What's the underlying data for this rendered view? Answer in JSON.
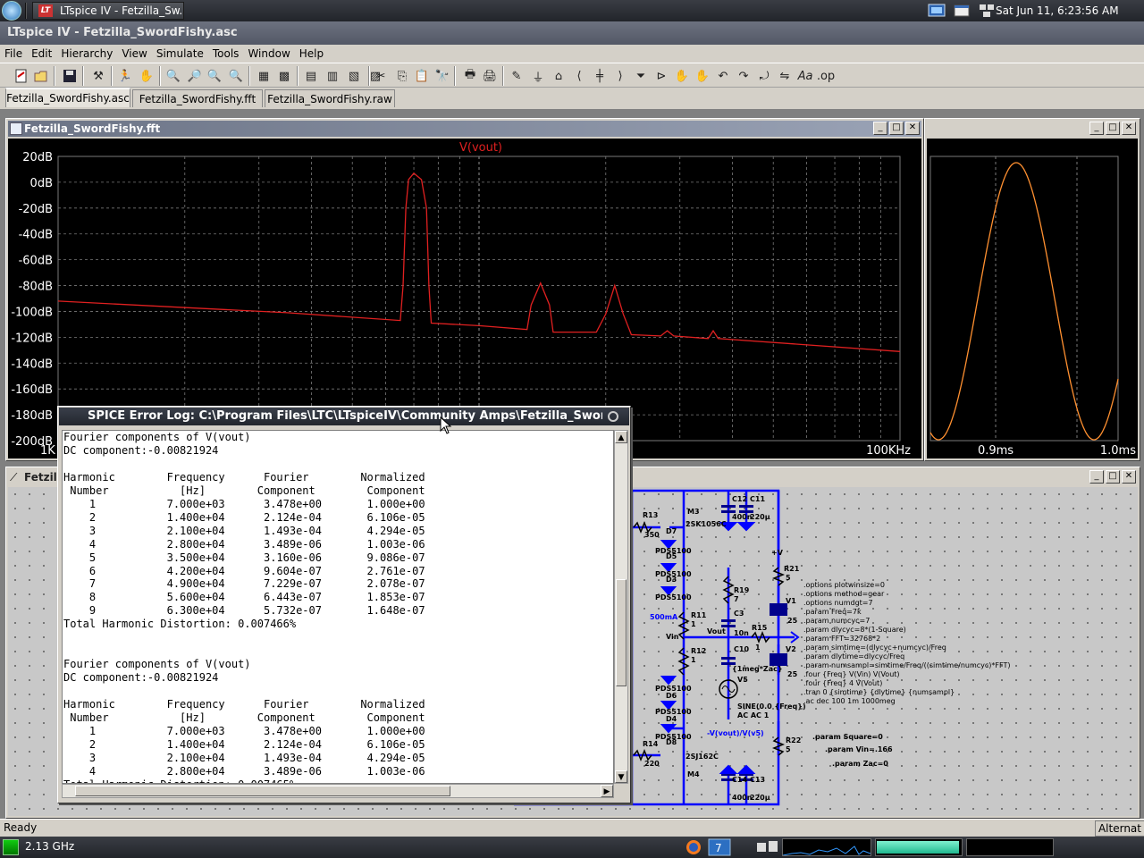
{
  "system_panel": {
    "task_title": "LTspice IV - Fetzilla_Sw...",
    "clock": "Sat Jun 11,  6:23:56 AM"
  },
  "app": {
    "title": "LTspice IV - Fetzilla_SwordFishy.asc",
    "menu": [
      "File",
      "Edit",
      "Hierarchy",
      "View",
      "Simulate",
      "Tools",
      "Window",
      "Help"
    ],
    "tabs": [
      "Fetzilla_SwordFishy.asc",
      "Fetzilla_SwordFishy.fft",
      "Fetzilla_SwordFishy.raw"
    ],
    "active_tab": 0
  },
  "fft_window": {
    "title": "Fetzilla_SwordFishy.fft",
    "trace_label": "V(vout)",
    "colors": {
      "trace": "#e02020",
      "grid": "#7a7a7a",
      "axis_text": "#ffffff",
      "background": "#000000"
    }
  },
  "chart_data": [
    {
      "type": "line",
      "title": "V(vout)",
      "xscale": "log",
      "xlim": [
        1000,
        100000
      ],
      "x_ticks": [
        "1K",
        "100KHz"
      ],
      "ylim": [
        -200,
        20
      ],
      "y_ticks": [
        "20dB",
        "0dB",
        "-20dB",
        "-40dB",
        "-60dB",
        "-80dB",
        "-100dB",
        "-120dB",
        "-140dB",
        "-160dB",
        "-180dB",
        "-200dB"
      ],
      "series": [
        {
          "name": "V(vout)",
          "color": "#e02020",
          "points": [
            [
              1000,
              -92
            ],
            [
              3500,
              -101
            ],
            [
              6500,
              -107
            ],
            [
              6600,
              -80
            ],
            [
              6700,
              -20
            ],
            [
              6800,
              2
            ],
            [
              7000,
              7
            ],
            [
              7300,
              2
            ],
            [
              7500,
              -20
            ],
            [
              7600,
              -80
            ],
            [
              7700,
              -109
            ],
            [
              10000,
              -111
            ],
            [
              13000,
              -114
            ],
            [
              13300,
              -95
            ],
            [
              14000,
              -78
            ],
            [
              14700,
              -95
            ],
            [
              15000,
              -116
            ],
            [
              19000,
              -116
            ],
            [
              20000,
              -102
            ],
            [
              21000,
              -80
            ],
            [
              22000,
              -102
            ],
            [
              23000,
              -118
            ],
            [
              27000,
              -119
            ],
            [
              28000,
              -115
            ],
            [
              29000,
              -119
            ],
            [
              35000,
              -121
            ],
            [
              36000,
              -115
            ],
            [
              37000,
              -121
            ],
            [
              100000,
              -131
            ]
          ]
        }
      ]
    },
    {
      "type": "line",
      "title": "",
      "x_ticks": [
        "0.9ms",
        "1.0ms"
      ],
      "series": [
        {
          "color": "#ff9030",
          "shape": "sine"
        }
      ]
    }
  ],
  "scope_window": {
    "colors": {
      "trace": "#ff9030"
    }
  },
  "schematic_window": {
    "title": "Fetzilla_SwordFishy.asc",
    "colors": {
      "wire": "#0000ff",
      "text": "#000000"
    },
    "labels": {
      "r13": "R13",
      "r13v": "350",
      "m3": "M3",
      "m3v": "2SK1056C",
      "d7": "D7",
      "d5": "D5",
      "d3": "D3",
      "pd1": "PDS5100",
      "pd2": "PDS5100",
      "pd3": "PDS5100",
      "c12": "C12",
      "c11": "C11",
      "c12v": "400n",
      "c11v": "220µ",
      "r11": "R11",
      "r11v": "1",
      "r19": "R19",
      "r19v": "7",
      "c3": "C3",
      "c3v": "10n",
      "vout": "Vout",
      "vin": "Vin",
      "r15": "R15",
      "r15v": "1",
      "r12": "R12",
      "r12v": "1",
      "c10": "C10",
      "c10v": "{1meg*Zac}",
      "v5": "V5",
      "sine": "SINE(0.0 {Freq})",
      "acac": "AC AC 1",
      "ratio": "-V(vout)/V(v5)",
      "r21": "R21",
      "r21v": "5",
      "r22": "R22",
      "r22v": "5",
      "v1": "V1",
      "v2": "V2",
      "v25a": "25",
      "v25b": "25",
      "plusv": "+V",
      "d6": "D6",
      "d4": "D4",
      "d8": "D8",
      "pd4": "PDS5100",
      "pd5": "PDS5100",
      "pd6": "PDS5100",
      "r14": "R14",
      "r14v": "220",
      "m4": "M4",
      "m4v": "2SJ162C",
      "c14": "C14",
      "c13": "C13",
      "c14v": "400n",
      "c13v": "220µ",
      "ma": "500mA"
    },
    "directives": [
      ".options plotwinsize=0",
      ".options method=gear",
      ".options numdgt=7",
      ".param Freq=7k",
      ".param numcyc=7",
      ".param dlycyc=8*(1-Square)",
      ".param FFT=32768*2",
      ".param simtime=(dlycyc+numcyc)/Freq",
      ".param dlytime=dlycyc/Freq",
      ".param numsampl=simtime/Freq/((simtime/numcyc)*FFT)",
      ".four {Freq} V(Vin) V(Vout)",
      ".four {Freq} 4 V(Vout)",
      ".tran 0 {simtime} {dlytime} {numsampl}",
      ".ac dec 100 1m 1000meg"
    ],
    "params": [
      ".param Square=0",
      ".param Vin=.166",
      ".param Zac=0"
    ]
  },
  "error_log": {
    "title": "SPICE Error Log: C:\\Program Files\\LTC\\LTspiceIV\\Community Amps\\Fetzilla_SwordFishy",
    "lines": [
      "Fourier components of V(vout)",
      "DC component:-0.00821924",
      "",
      "Harmonic        Frequency      Fourier        Normalized",
      " Number           [Hz]        Component        Component",
      "    1           7.000e+03      3.478e+00       1.000e+00",
      "    2           1.400e+04      2.124e-04       6.106e-05",
      "    3           2.100e+04      1.493e-04       4.294e-05",
      "    4           2.800e+04      3.489e-06       1.003e-06",
      "    5           3.500e+04      3.160e-06       9.086e-07",
      "    6           4.200e+04      9.604e-07       2.761e-07",
      "    7           4.900e+04      7.229e-07       2.078e-07",
      "    8           5.600e+04      6.443e-07       1.853e-07",
      "    9           6.300e+04      5.732e-07       1.648e-07",
      "Total Harmonic Distortion: 0.007466%",
      "",
      "",
      "Fourier components of V(vout)",
      "DC component:-0.00821924",
      "",
      "Harmonic        Frequency      Fourier        Normalized",
      " Number           [Hz]        Component        Component",
      "    1           7.000e+03      3.478e+00       1.000e+00",
      "    2           1.400e+04      2.124e-04       6.106e-05",
      "    3           2.100e+04      1.493e-04       4.294e-05",
      "    4           2.800e+04      3.489e-06       1.003e-06",
      "Total Harmonic Distortion: 0.007465%"
    ]
  },
  "status_bar": {
    "left": "Ready",
    "right": "Alternat"
  },
  "bottom_panel": {
    "cpu": "2.13 GHz",
    "memory_fill": 0.96
  }
}
